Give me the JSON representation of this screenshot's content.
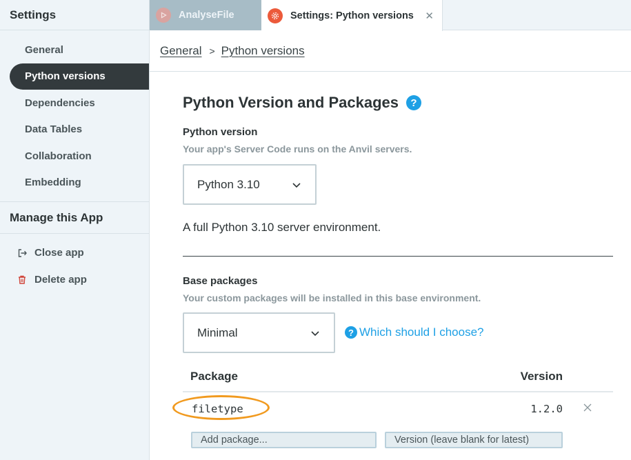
{
  "sidebar": {
    "title": "Settings",
    "items": [
      {
        "label": "General",
        "active": false
      },
      {
        "label": "Python versions",
        "active": true
      },
      {
        "label": "Dependencies",
        "active": false
      },
      {
        "label": "Data Tables",
        "active": false
      },
      {
        "label": "Collaboration",
        "active": false
      },
      {
        "label": "Embedding",
        "active": false
      }
    ],
    "manage_title": "Manage this App",
    "manage_items": [
      {
        "label": "Close app",
        "icon": "exit-icon"
      },
      {
        "label": "Delete app",
        "icon": "trash-icon"
      }
    ]
  },
  "tabs": [
    {
      "label": "AnalyseFile",
      "icon": "play-icon",
      "active": false
    },
    {
      "label": "Settings: Python versions",
      "icon": "gear-icon",
      "active": true,
      "close_glyph": "✕"
    }
  ],
  "breadcrumb": {
    "items": [
      "General",
      "Python versions"
    ],
    "separator": ">"
  },
  "main": {
    "title": "Python Version and Packages",
    "help_glyph": "?",
    "python_version": {
      "label": "Python version",
      "hint": "Your app's Server Code runs on the Anvil servers.",
      "selected": "Python 3.10",
      "description": "A full Python 3.10 server environment."
    },
    "base_packages": {
      "label": "Base packages",
      "hint": "Your custom packages will be installed in this base environment.",
      "selected": "Minimal",
      "help_link": "Which should I choose?"
    },
    "packages_table": {
      "columns": [
        "Package",
        "Version"
      ],
      "rows": [
        {
          "name": "filetype",
          "version": "1.2.0",
          "highlighted": true
        }
      ]
    },
    "add_package_placeholder": "Add package...",
    "version_placeholder": "Version (leave blank for latest)"
  },
  "colors": {
    "accent": "#1ea0e5",
    "highlight_oval": "#f19a1f",
    "active_nav": "#333a3d",
    "settings_tab_icon": "#ec5a3a"
  }
}
